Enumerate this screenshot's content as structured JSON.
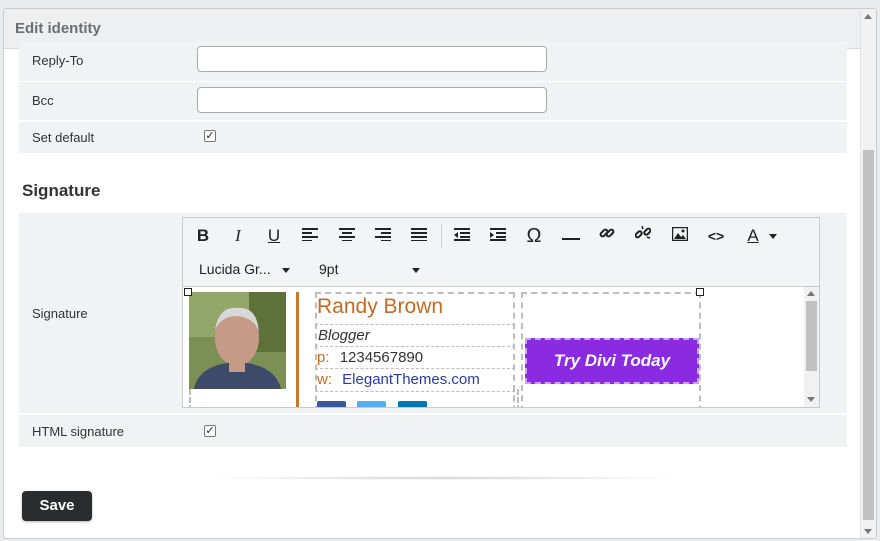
{
  "dialog": {
    "title": "Edit identity"
  },
  "fields": {
    "reply_to": {
      "label": "Reply-To",
      "value": ""
    },
    "bcc": {
      "label": "Bcc",
      "value": ""
    },
    "set_default": {
      "label": "Set default",
      "checked": true
    }
  },
  "signature_section": {
    "title": "Signature",
    "field_label": "Signature",
    "toolbar": {
      "icons": [
        "bold-icon",
        "italic-icon",
        "underline-icon",
        "align-left-icon",
        "align-center-icon",
        "align-right-icon",
        "align-justify-icon",
        "outdent-icon",
        "indent-icon",
        "special-char-icon",
        "horizontal-rule-icon",
        "link-icon",
        "unlink-icon",
        "image-icon",
        "source-code-icon",
        "text-color-icon"
      ],
      "font_family": "Lucida Gr...",
      "font_size": "9pt"
    },
    "content": {
      "name": "Randy Brown",
      "role": "Blogger",
      "phone_key": "p:",
      "phone": "1234567890",
      "web_key": "w:",
      "web": "ElegantThemes.com",
      "cta": "Try Divi Today"
    }
  },
  "html_signature": {
    "label": "HTML signature",
    "checked": true
  },
  "actions": {
    "save": "Save"
  },
  "colors": {
    "accent_orange": "#c46a24",
    "cta_purple": "#8a2be2",
    "link_blue": "#2b3aa8"
  }
}
